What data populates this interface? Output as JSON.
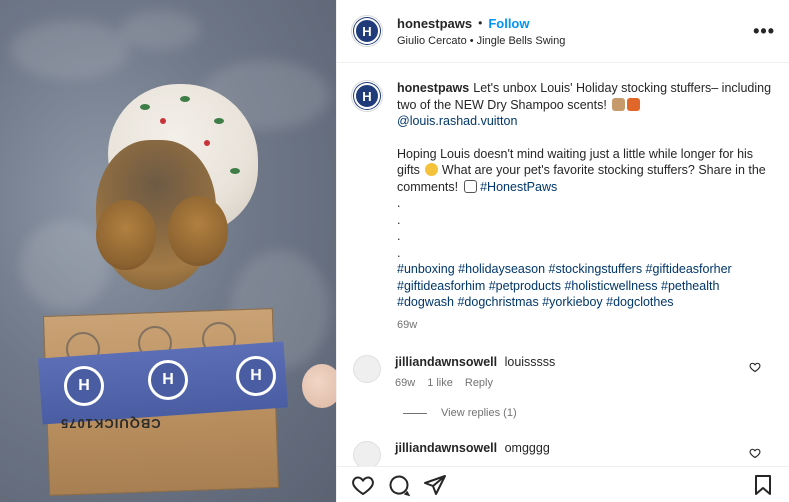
{
  "header": {
    "username": "honestpaws",
    "separator": "•",
    "follow_label": "Follow",
    "audio": "Giulio Cercato • Jingle Bells Swing",
    "avatar_letter": "H",
    "more_label": "•••"
  },
  "caption": {
    "username": "honestpaws",
    "line1": "Let's unbox Louis' Holiday stocking stuffers– including two of the NEW Dry Shampoo scents!",
    "mention": "@louis.rashad.vuitton",
    "para2": "Hoping Louis doesn't mind waiting just a little while longer for his gifts",
    "para2b": "What are your pet's favorite stocking stuffers? Share in the comments!",
    "tag": "#HonestPaws",
    "dots": [
      ".",
      ".",
      ".",
      "."
    ],
    "hashtags": "#unboxing #holidayseason #stockingstuffers #giftideasforher #giftideasforhim #petproducts #holisticwellness #pethealth #dogwash #dogchristmas #yorkieboy #dogclothes",
    "timestamp": "69w"
  },
  "comments": [
    {
      "username": "jilliandawnsowell",
      "text": "louisssss",
      "time": "69w",
      "likes": "1 like",
      "reply_label": "Reply",
      "view_replies": "View replies (1)"
    },
    {
      "username": "jilliandawnsowell",
      "text": "omgggg"
    }
  ],
  "media": {
    "box_text": "CBQUICK1075",
    "tape_letter": "H"
  },
  "colors": {
    "link": "#00376b",
    "follow": "#0095f6",
    "brand": "#1f3b7a"
  },
  "icons": [
    "heart-icon",
    "comment-icon",
    "share-icon",
    "bookmark-icon",
    "more-icon"
  ]
}
